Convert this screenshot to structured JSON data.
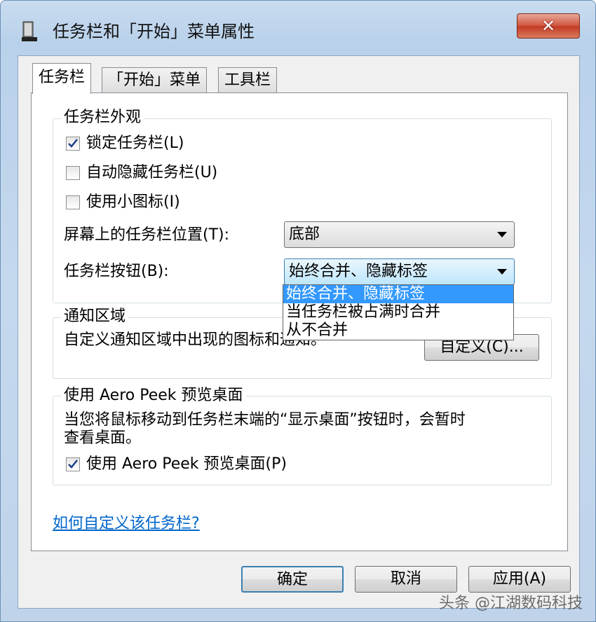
{
  "window": {
    "title": "任务栏和「开始」菜单属性",
    "close_label": "✕"
  },
  "tabs": [
    {
      "label": "任务栏",
      "active": true
    },
    {
      "label": "「开始」菜单",
      "active": false
    },
    {
      "label": "工具栏",
      "active": false
    }
  ],
  "appearance": {
    "group_title": "任务栏外观",
    "lock_taskbar": {
      "label": "锁定任务栏(L)",
      "checked": true
    },
    "auto_hide": {
      "label": "自动隐藏任务栏(U)",
      "checked": false
    },
    "small_icons": {
      "label": "使用小图标(I)",
      "checked": false
    },
    "position_label": "屏幕上的任务栏位置(T):",
    "position_value": "底部",
    "buttons_label": "任务栏按钮(B):",
    "buttons_value": "始终合并、隐藏标签",
    "buttons_options": [
      "始终合并、隐藏标签",
      "当任务栏被占满时合并",
      "从不合并"
    ]
  },
  "notification": {
    "group_title": "通知区域",
    "description": "自定义通知区域中出现的图标和通知。",
    "customize_button": "自定义(C)..."
  },
  "aero_peek": {
    "group_title": "使用 Aero Peek 预览桌面",
    "description_line1": "当您将鼠标移动到任务栏末端的“显示桌面”按钮时，会暂时",
    "description_line2": "查看桌面。",
    "checkbox": {
      "label": "使用 Aero Peek 预览桌面(P)",
      "checked": true
    }
  },
  "help_link": "如何自定义该任务栏?",
  "buttons": {
    "ok": "确定",
    "cancel": "取消",
    "apply": "应用(A)"
  },
  "watermark": "头条 @江湖数码科技"
}
